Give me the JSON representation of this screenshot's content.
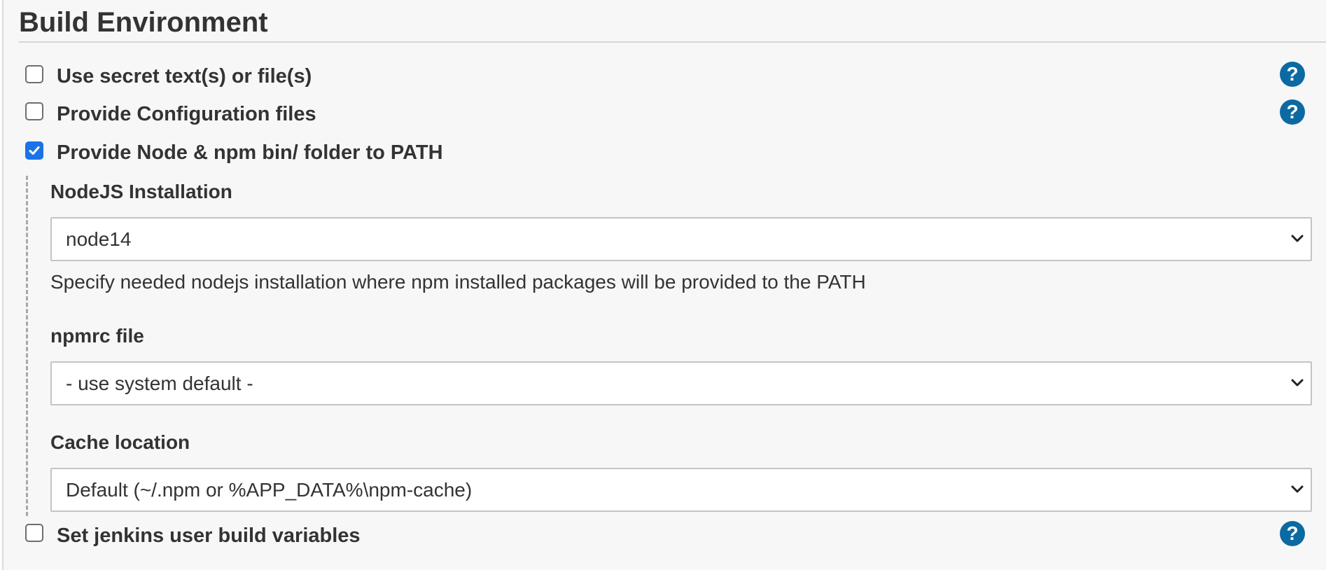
{
  "section": {
    "title": "Build Environment"
  },
  "options": [
    {
      "label": "Use secret text(s) or file(s)",
      "checked": false,
      "help": "?"
    },
    {
      "label": "Provide Configuration files",
      "checked": false,
      "help": "?"
    },
    {
      "label": "Provide Node & npm bin/ folder to PATH",
      "checked": true
    },
    {
      "label": "Set jenkins user build variables",
      "checked": false,
      "help": "?"
    }
  ],
  "node_settings": {
    "nodejs_installation": {
      "label": "NodeJS Installation",
      "value": "node14",
      "description": "Specify needed nodejs installation where npm installed packages will be provided to the PATH"
    },
    "npmrc_file": {
      "label": "npmrc file",
      "value": "- use system default -"
    },
    "cache_location": {
      "label": "Cache location",
      "value": "Default (~/.npm or %APP_DATA%\\npm-cache)"
    }
  },
  "icons": {
    "help": "help-icon",
    "checkmark": "check-icon",
    "dropdown": "chevron-down-icon"
  },
  "colors": {
    "help_badge": "#0b6aa2",
    "checkbox_checked": "#1a73e8",
    "panel_background": "#f7f7f7"
  }
}
